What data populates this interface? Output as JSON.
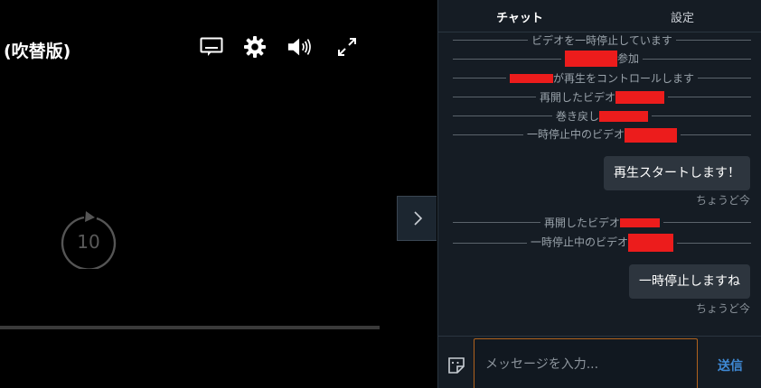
{
  "video": {
    "title": "(吹替版)",
    "rewind_label": "10",
    "progress": 1.0
  },
  "controls": {
    "icons": [
      "subtitles-icon",
      "gear-icon",
      "volume-icon",
      "fullscreen-icon"
    ]
  },
  "chat": {
    "tabs": [
      {
        "label": "チャット",
        "active": true
      },
      {
        "label": "設定",
        "active": false
      }
    ],
    "system_messages": [
      {
        "text": "ビデオを一時停止しています"
      },
      {
        "text_after": "参加"
      },
      {
        "text_after": "が再生をコントロールします"
      },
      {
        "text_before": "再開したビデオ"
      },
      {
        "text_before": "巻き戻し"
      },
      {
        "text_before": "一時停止中のビデオ"
      },
      {
        "text_before": "再開したビデオ"
      },
      {
        "text_before": "一時停止中のビデオ"
      }
    ],
    "messages": [
      {
        "text": "再生スタートします！",
        "time": "ちょうど今"
      },
      {
        "text": "一時停止しますね",
        "time": "ちょうど今"
      }
    ],
    "composer": {
      "placeholder": "メッセージを入力...",
      "send_label": "送信"
    }
  },
  "colors": {
    "accent": "#3f8ad6",
    "redaction": "#ec1c1c",
    "input_border": "#b0621d"
  }
}
